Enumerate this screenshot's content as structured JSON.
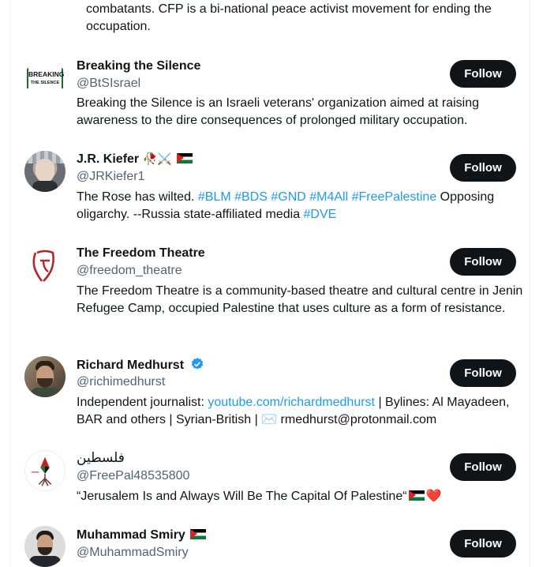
{
  "top_fragment": "combatants. CFP is a bi-national peace activist movement for ending the occupation.",
  "follow_label": "Follow",
  "accounts": [
    {
      "name": "Breaking the Silence",
      "handle": "@BtSIsrael",
      "bio": "Breaking the Silence is an Israeli veterans' organization aimed at raising awareness to the dire consequences of prolonged military occupation.",
      "logo_text_1": "BREAKING",
      "logo_text_2": "THE SILENCE"
    },
    {
      "name": "J.R. Kiefer",
      "name_emoji": "🥀⚔️",
      "handle": "@JRKiefer1",
      "bio_parts": [
        "The Rose has wilted. ",
        "#BLM #BDS #GND #M4All #FreePalestine",
        " Opposing oligarchy. --Russia state-affiliated media ",
        "#DVE"
      ]
    },
    {
      "name": "The Freedom Theatre",
      "handle": "@freedom_theatre",
      "bio": "The Freedom Theatre is a community-based theatre and cultural centre in Jenin Refugee Camp, occupied Palestine that uses culture as a form of resistance."
    },
    {
      "name": "Richard Medhurst",
      "handle": "@richimedhurst",
      "bio_parts": [
        "Independent journalist: ",
        "youtube.com/richardmedhurst",
        " | Bylines: Al Mayadeen, BAR and others | Syrian-British | ✉️ rmedhurst@protonmail.com"
      ]
    },
    {
      "name": "فلسطين",
      "handle": "@FreePal48535800",
      "bio": "“Jerusalem Is and Always Will Be The Capital Of Palestine“",
      "bio_heart": "❤️"
    },
    {
      "name": "Muhammad Smiry",
      "handle": "@MuhammadSmiry"
    }
  ],
  "colors": {
    "link": "#1d9bf0",
    "handle": "#536471",
    "button": "#0f1419",
    "verified": "#1d9bf0"
  }
}
